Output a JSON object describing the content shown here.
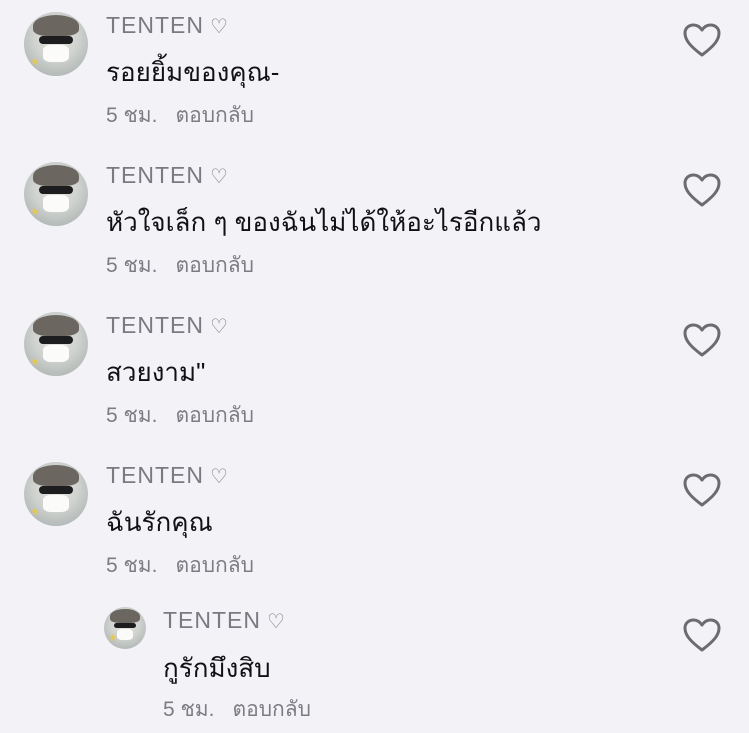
{
  "comments": [
    {
      "username": "TENTEN",
      "username_heart": "♡",
      "text": "รอยยิ้มของคุณ-",
      "time": "5 ชม.",
      "reply_label": "ตอบกลับ",
      "like_icon": "heart-outline-icon"
    },
    {
      "username": "TENTEN",
      "username_heart": "♡",
      "text": "หัวใจเล็ก ๆ ของฉันไม่ได้ให้อะไรอีกแล้ว",
      "time": "5 ชม.",
      "reply_label": "ตอบกลับ",
      "like_icon": "heart-outline-icon"
    },
    {
      "username": "TENTEN",
      "username_heart": "♡",
      "text": "สวยงาม\"",
      "time": "5 ชม.",
      "reply_label": "ตอบกลับ",
      "like_icon": "heart-outline-icon"
    },
    {
      "username": "TENTEN",
      "username_heart": "♡",
      "text": "ฉันรักคุณ",
      "time": "5 ชม.",
      "reply_label": "ตอบกลับ",
      "like_icon": "heart-outline-icon"
    }
  ],
  "reply": {
    "username": "TENTEN",
    "username_heart": "♡",
    "text": "กูรักมึงสิบ",
    "time": "5 ชม.",
    "reply_label": "ตอบกลับ",
    "like_icon": "heart-outline-icon"
  },
  "colors": {
    "background": "#f3f2f7",
    "username": "#7a7a80",
    "text": "#111113",
    "meta": "#7c7c82",
    "icon": "#6b6b70"
  }
}
